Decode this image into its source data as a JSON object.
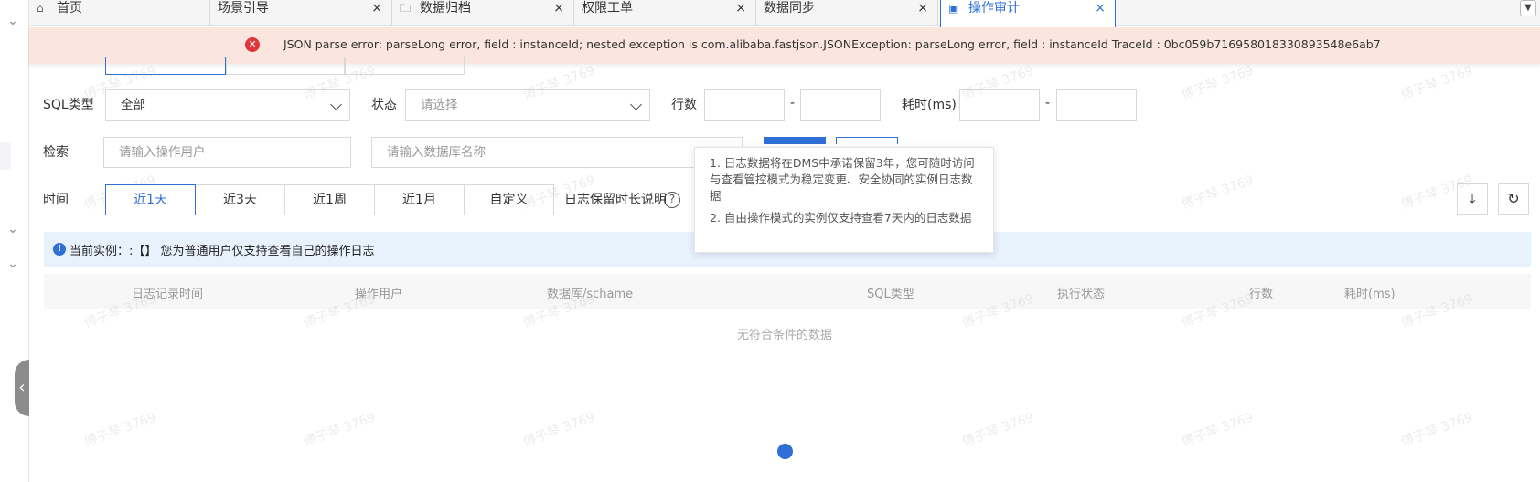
{
  "tabs": [
    {
      "label": "首页",
      "icon": "home-icon",
      "glyph": "⌂"
    },
    {
      "label": "场景引导",
      "close": "×"
    },
    {
      "label": "数据归档",
      "icon": "archive-icon",
      "glyph": "🗀",
      "close": "×"
    },
    {
      "label": "权限工单",
      "close": "×"
    },
    {
      "label": "数据同步",
      "close": "×"
    },
    {
      "label": "操作审计",
      "icon": "audit-icon",
      "glyph": "▣",
      "close": "×"
    }
  ],
  "error": {
    "icon_glyph": "✕",
    "message": "JSON parse error: parseLong error, field : instanceId; nested exception is com.alibaba.fastjson.JSONException: parseLong error, field : instanceId TraceId : 0bc059b716958018330893548e6ab7"
  },
  "filters": {
    "sql_type_label": "SQL类型",
    "sql_type_value": "全部",
    "status_label": "状态",
    "status_placeholder": "请选择",
    "rows_label": "行数",
    "duration_label": "耗时(ms)",
    "range_sep": "-",
    "search_label": "检索",
    "user_placeholder": "请输入操作用户",
    "db_placeholder": "请输入数据库名称",
    "time_label": "时间",
    "time_options": [
      "近1天",
      "近3天",
      "近1周",
      "近1月",
      "自定义"
    ],
    "time_selected": "近1天",
    "retention_label": "日志保留时长说明"
  },
  "tooltip": {
    "line1": "1. 日志数据将在DMS中承诺保留3年，您可随时访问与查看管控模式为稳定变更、安全协同的实例日志数据",
    "line2": "2. 自由操作模式的实例仅支持查看7天内的日志数据"
  },
  "notice": {
    "icon_glyph": "!",
    "text": "当前实例：:【】 您为普通用户仅支持查看自己的操作日志"
  },
  "table": {
    "columns": [
      "日志记录时间",
      "操作用户",
      "数据库/schame",
      "SQL类型",
      "执行状态",
      "行数",
      "耗时(ms)"
    ],
    "empty_text": "无符合条件的数据"
  },
  "watermark": "傅子琴 3769",
  "colors": {
    "primary": "#2f6fd6",
    "error_bg": "#fbe6df",
    "error_icon": "#e0353a",
    "info_bg": "#e8f2fd"
  }
}
